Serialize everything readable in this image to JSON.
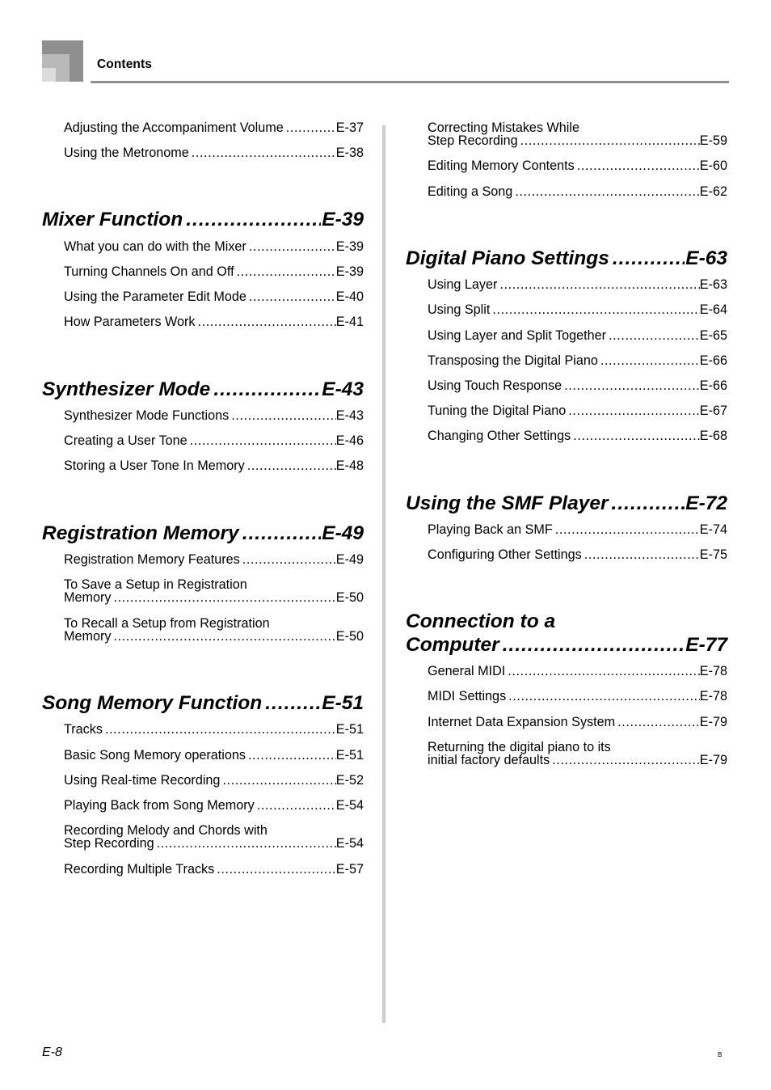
{
  "header": {
    "title": "Contents",
    "logo_icon": "nested-squares-logo-icon",
    "logo_colors": [
      "#8f8f8f",
      "#b9b9b9",
      "#dcdcdc"
    ],
    "rule_color": "#8f8f8f"
  },
  "footer": {
    "page_label": "E-8",
    "edition_mark": "B"
  },
  "divider_color": "#cccccc",
  "leader_dots": "..................................................................................................",
  "columns": [
    {
      "name": "left-column",
      "blocks": [
        {
          "kind": "entry",
          "lines": [
            "Adjusting the Accompaniment Volume"
          ],
          "page": "E-37"
        },
        {
          "kind": "entry",
          "lines": [
            "Using the Metronome"
          ],
          "page": "E-38"
        },
        {
          "kind": "gap",
          "size": "lg"
        },
        {
          "kind": "heading",
          "lines": [
            "Mixer Function"
          ],
          "page": "E-39"
        },
        {
          "kind": "entry",
          "lines": [
            "What you can do with the Mixer"
          ],
          "page": "E-39"
        },
        {
          "kind": "entry",
          "lines": [
            "Turning Channels On and Off"
          ],
          "page": "E-39"
        },
        {
          "kind": "entry",
          "lines": [
            "Using the Parameter Edit Mode"
          ],
          "page": "E-40"
        },
        {
          "kind": "entry",
          "lines": [
            "How Parameters Work"
          ],
          "page": "E-41"
        },
        {
          "kind": "gap",
          "size": "lg"
        },
        {
          "kind": "heading",
          "lines": [
            "Synthesizer Mode"
          ],
          "page": "E-43"
        },
        {
          "kind": "entry",
          "lines": [
            "Synthesizer Mode Functions"
          ],
          "page": "E-43"
        },
        {
          "kind": "entry",
          "lines": [
            "Creating a User Tone"
          ],
          "page": "E-46"
        },
        {
          "kind": "entry",
          "lines": [
            "Storing a User Tone In Memory"
          ],
          "page": "E-48"
        },
        {
          "kind": "gap",
          "size": "lg"
        },
        {
          "kind": "heading",
          "lines": [
            "Registration Memory"
          ],
          "page": "E-49"
        },
        {
          "kind": "entry",
          "lines": [
            "Registration Memory Features"
          ],
          "page": "E-49"
        },
        {
          "kind": "entry",
          "lines": [
            "To Save a Setup in Registration",
            "Memory"
          ],
          "page": "E-50"
        },
        {
          "kind": "entry",
          "lines": [
            "To Recall a Setup from Registration",
            "Memory"
          ],
          "page": "E-50"
        },
        {
          "kind": "gap",
          "size": "lg"
        },
        {
          "kind": "heading",
          "lines": [
            "Song Memory Function"
          ],
          "page": "E-51"
        },
        {
          "kind": "entry",
          "lines": [
            "Tracks"
          ],
          "page": "E-51"
        },
        {
          "kind": "entry",
          "lines": [
            "Basic Song Memory operations"
          ],
          "page": "E-51"
        },
        {
          "kind": "entry",
          "lines": [
            "Using Real-time Recording"
          ],
          "page": "E-52"
        },
        {
          "kind": "entry",
          "lines": [
            "Playing Back from Song Memory"
          ],
          "page": "E-54"
        },
        {
          "kind": "entry",
          "lines": [
            "Recording Melody and Chords with",
            "Step Recording"
          ],
          "page": "E-54"
        },
        {
          "kind": "entry",
          "lines": [
            "Recording Multiple Tracks"
          ],
          "page": "E-57"
        }
      ]
    },
    {
      "name": "right-column",
      "blocks": [
        {
          "kind": "entry",
          "lines": [
            "Correcting Mistakes While",
            "Step Recording"
          ],
          "page": "E-59"
        },
        {
          "kind": "entry",
          "lines": [
            "Editing Memory Contents"
          ],
          "page": "E-60"
        },
        {
          "kind": "entry",
          "lines": [
            "Editing a Song"
          ],
          "page": "E-62"
        },
        {
          "kind": "gap",
          "size": "lg"
        },
        {
          "kind": "heading",
          "lines": [
            "Digital Piano Settings"
          ],
          "page": "E-63"
        },
        {
          "kind": "entry",
          "lines": [
            "Using Layer"
          ],
          "page": "E-63"
        },
        {
          "kind": "entry",
          "lines": [
            "Using Split"
          ],
          "page": "E-64"
        },
        {
          "kind": "entry",
          "lines": [
            "Using Layer and Split Together"
          ],
          "page": "E-65"
        },
        {
          "kind": "entry",
          "lines": [
            "Transposing the Digital Piano"
          ],
          "page": "E-66"
        },
        {
          "kind": "entry",
          "lines": [
            "Using Touch Response"
          ],
          "page": "E-66"
        },
        {
          "kind": "entry",
          "lines": [
            "Tuning the Digital Piano"
          ],
          "page": "E-67"
        },
        {
          "kind": "entry",
          "lines": [
            "Changing Other Settings"
          ],
          "page": "E-68"
        },
        {
          "kind": "gap",
          "size": "lg"
        },
        {
          "kind": "heading",
          "lines": [
            "Using the SMF Player"
          ],
          "page": "E-72"
        },
        {
          "kind": "entry",
          "lines": [
            "Playing Back an SMF"
          ],
          "page": "E-74"
        },
        {
          "kind": "entry",
          "lines": [
            "Configuring Other Settings"
          ],
          "page": "E-75"
        },
        {
          "kind": "gap",
          "size": "lg"
        },
        {
          "kind": "heading",
          "lines": [
            "Connection to a",
            "Computer"
          ],
          "page": "E-77"
        },
        {
          "kind": "entry",
          "lines": [
            "General MIDI"
          ],
          "page": "E-78"
        },
        {
          "kind": "entry",
          "lines": [
            "MIDI Settings"
          ],
          "page": "E-78"
        },
        {
          "kind": "entry",
          "lines": [
            "Internet Data Expansion System"
          ],
          "page": "E-79"
        },
        {
          "kind": "entry",
          "lines": [
            "Returning the digital piano to its",
            "initial factory defaults"
          ],
          "page": "E-79"
        }
      ]
    }
  ]
}
